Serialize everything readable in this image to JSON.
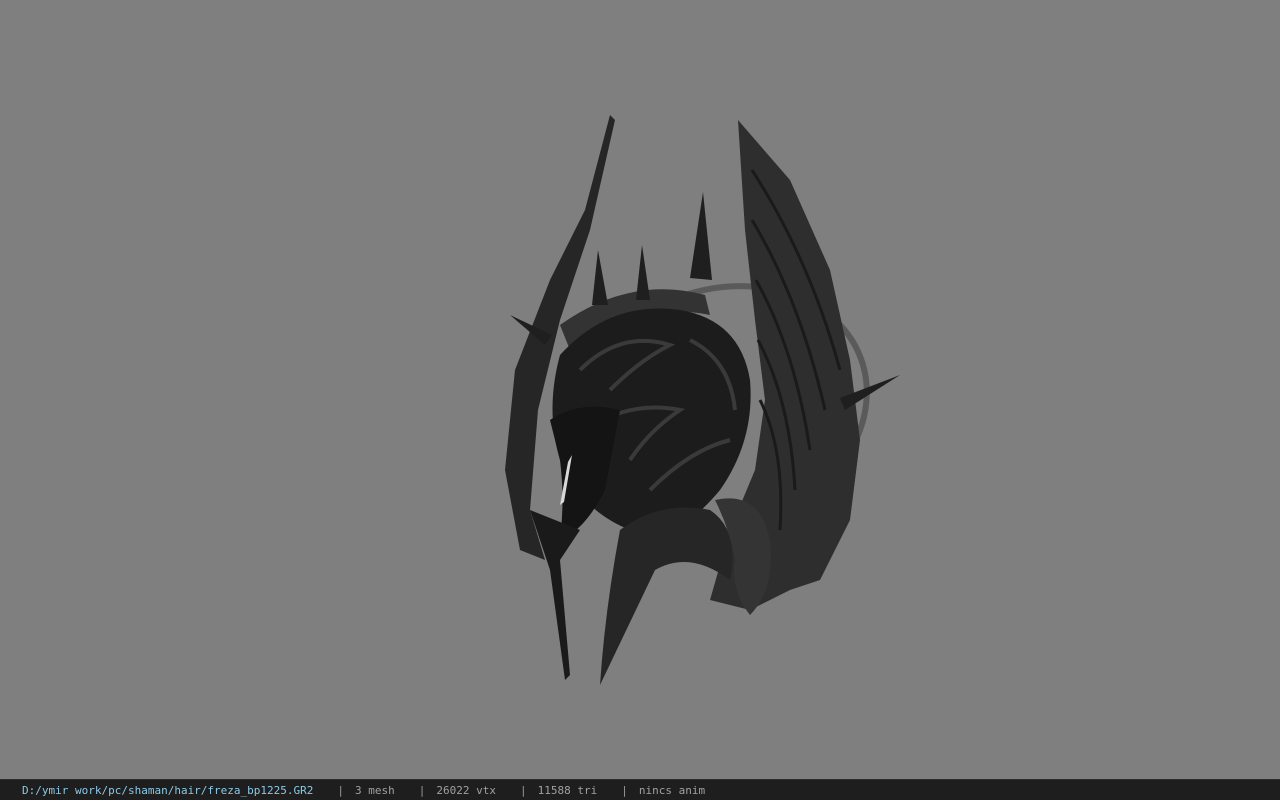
{
  "window": {
    "background_color": "#7f7f7f"
  },
  "viewport": {
    "model": "helmet-model"
  },
  "statusbar": {
    "file_path": "D:/ymir work/pc/shaman/hair/freza_bp1225.GR2",
    "separator": "|",
    "mesh_count": "3 mesh",
    "vertex_count": "26022 vtx",
    "triangle_count": "11588 tri",
    "animation_status": "nincs anim",
    "path_color": "#8cc8e6",
    "text_color": "#a0a0a0"
  }
}
